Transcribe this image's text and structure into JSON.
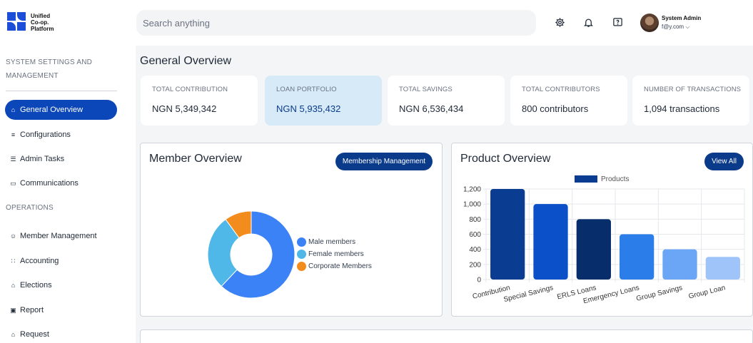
{
  "app": {
    "logo_lines": [
      "Unified",
      "Co-op.",
      "Platform"
    ],
    "brand_color": "#1d4ed8"
  },
  "sidebar": {
    "section1": [
      "SYSTEM SETTINGS AND",
      "MANAGEMENT"
    ],
    "section2": "OPERATIONS",
    "items": [
      {
        "label": "General Overview",
        "icon": "home-icon",
        "glyph": "⌂"
      },
      {
        "label": "Configurations",
        "icon": "config-icon",
        "glyph": "≡"
      },
      {
        "label": "Admin Tasks",
        "icon": "tasks-icon",
        "glyph": "☰"
      },
      {
        "label": "Communications",
        "icon": "chat-icon",
        "glyph": "▭"
      },
      {
        "label": "Member Management",
        "icon": "people-icon",
        "glyph": "☺"
      },
      {
        "label": "Accounting",
        "icon": "accounting-icon",
        "glyph": "∷"
      },
      {
        "label": "Elections",
        "icon": "elections-icon",
        "glyph": "⌂"
      },
      {
        "label": "Report",
        "icon": "report-icon",
        "glyph": "▣"
      },
      {
        "label": "Request",
        "icon": "request-icon",
        "glyph": "⌂"
      }
    ]
  },
  "header": {
    "search_placeholder": "Search anything",
    "icons": [
      "gear-icon",
      "bell-icon",
      "help-icon"
    ],
    "user_name": "System Admin",
    "user_email": "f@y.com"
  },
  "main": {
    "title": "General Overview",
    "stats": [
      {
        "label": "TOTAL CONTRIBUTION",
        "value": "NGN 5,349,342"
      },
      {
        "label": "LOAN PORTFOLIO",
        "value": "NGN 5,935,432"
      },
      {
        "label": "TOTAL SAVINGS",
        "value": "NGN 6,536,434"
      },
      {
        "label": "TOTAL CONTRIBUTORS",
        "value": "800 contributors"
      },
      {
        "label": "NUMBER OF TRANSACTIONS",
        "value": "1,094 transactions"
      }
    ],
    "member_card": {
      "title": "Member Overview",
      "button": "Membership Management"
    },
    "product_card": {
      "title": "Product Overview",
      "button": "View All"
    }
  },
  "chart_data": [
    {
      "type": "pie",
      "variant": "doughnut",
      "title": "",
      "categories": [
        "Male members",
        "Female members",
        "Corporate Members"
      ],
      "values": [
        62,
        28,
        10
      ],
      "colors": [
        "#3b82f6",
        "#4fb8e8",
        "#f28c1c"
      ],
      "legend": "right"
    },
    {
      "type": "bar",
      "title": "",
      "categories": [
        "Contribution",
        "Special Savings",
        "ERLS Loans",
        "Emergency Loans",
        "Group Savings",
        "Group Loan"
      ],
      "series": [
        {
          "name": "Products",
          "values": [
            1200,
            1000,
            800,
            600,
            400,
            300
          ]
        }
      ],
      "colors": [
        "#0a3d91",
        "#0b4fc9",
        "#072d6b",
        "#2b7de9",
        "#6aa6f5",
        "#9ec4fa"
      ],
      "ylim": [
        0,
        1200
      ],
      "yticks": [
        0,
        200,
        400,
        600,
        800,
        1000,
        1200
      ],
      "ytick_labels": [
        "0",
        "200",
        "400",
        "600",
        "800",
        "1,000",
        "1,200"
      ],
      "legend": "top",
      "grid": true
    }
  ]
}
